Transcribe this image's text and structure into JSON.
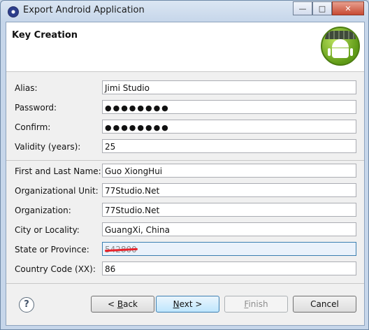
{
  "window": {
    "title": "Export Android Application",
    "buttons": {
      "minimize": "—",
      "maximize": "□",
      "close": "✕"
    }
  },
  "header": {
    "title": "Key Creation",
    "logo_icon": "android-logo"
  },
  "fields": [
    {
      "label": "Alias:",
      "value": "Jimi Studio"
    },
    {
      "label": "Password:",
      "value": "●●●●●●●●"
    },
    {
      "label": "Confirm:",
      "value": "●●●●●●●●"
    },
    {
      "label": "Validity (years):",
      "value": "25"
    },
    {
      "label": "First and Last Name:",
      "value": "Guo XiongHui"
    },
    {
      "label": "Organizational Unit:",
      "value": "77Studio.Net"
    },
    {
      "label": "Organization:",
      "value": "77Studio.Net"
    },
    {
      "label": "City or Locality:",
      "value": "GuangXi, China"
    },
    {
      "label": "State or Province:",
      "value": "542800"
    },
    {
      "label": "Country Code (XX):",
      "value": "86"
    }
  ],
  "footer": {
    "help": "?",
    "back": {
      "mnemonic": "B",
      "rest": "ack",
      "prefix": "< "
    },
    "next": {
      "mnemonic": "N",
      "rest": "ext >"
    },
    "finish": {
      "mnemonic": "F",
      "rest": "inish"
    },
    "cancel": "Cancel"
  },
  "accent": "#3c7fb1"
}
